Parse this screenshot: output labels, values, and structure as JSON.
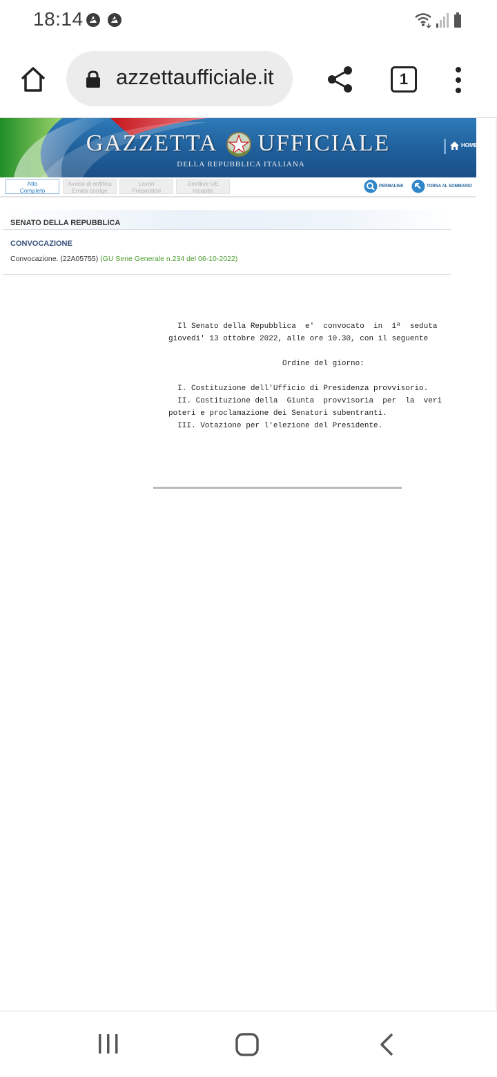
{
  "status_bar": {
    "time": "18:14",
    "notifications": [
      "app-notification-icon",
      "app-notification-icon"
    ],
    "indicators": [
      "wifi-icon",
      "signal-icon",
      "battery-icon"
    ]
  },
  "browser": {
    "url": "azzettaufficiale.it",
    "tab_count": "1",
    "icons": [
      "home-icon",
      "lock-icon",
      "share-icon",
      "tabs-icon",
      "menu-dots-icon"
    ]
  },
  "site": {
    "title_left": "GAZZETTA",
    "title_right": "UFFICIALE",
    "subtitle": "DELLA REPUBBLICA ITALIANA",
    "home_link": "HOME",
    "tabs": [
      {
        "line1": "Atto",
        "line2": "Completo",
        "active": true
      },
      {
        "line1": "Avviso di rettifica",
        "line2": "Errata corrige",
        "active": false
      },
      {
        "line1": "Lavori",
        "line2": "Preparatori",
        "active": false
      },
      {
        "line1": "Direttive UE",
        "line2": "recepite",
        "active": false
      }
    ],
    "permalink": "PERMALINK",
    "back_to_summary": "TORNA AL SOMMARIO",
    "colors": {
      "banner": "#1f5f9b",
      "active_tab": "#2c7fc4",
      "gu_link": "#4e9a2d"
    }
  },
  "act": {
    "organ": "SENATO DELLA REPUBBLICA",
    "category": "CONVOCAZIONE",
    "title": "Convocazione. (22A05755)",
    "gu_reference": "(GU Serie Generale n.234 del 06-10-2022)",
    "body_lines": [
      "  Il Senato della Repubblica  e'  convocato  in  1ª  seduta",
      "giovedi' 13 ottobre 2022, alle ore 10.30, con il seguente",
      "",
      "                         Ordine del giorno:",
      "",
      "  I. Costituzione dell'Ufficio di Presidenza provvisorio.",
      "  II. Costituzione della  Giunta  provvisoria  per  la  veri",
      "poteri e proclamazione dei Senatori subentranti.",
      "  III. Votazione per l'elezione del Presidente."
    ]
  },
  "nav_bar": {
    "icons": [
      "recent-apps-icon",
      "home-circle-icon",
      "back-icon"
    ]
  }
}
